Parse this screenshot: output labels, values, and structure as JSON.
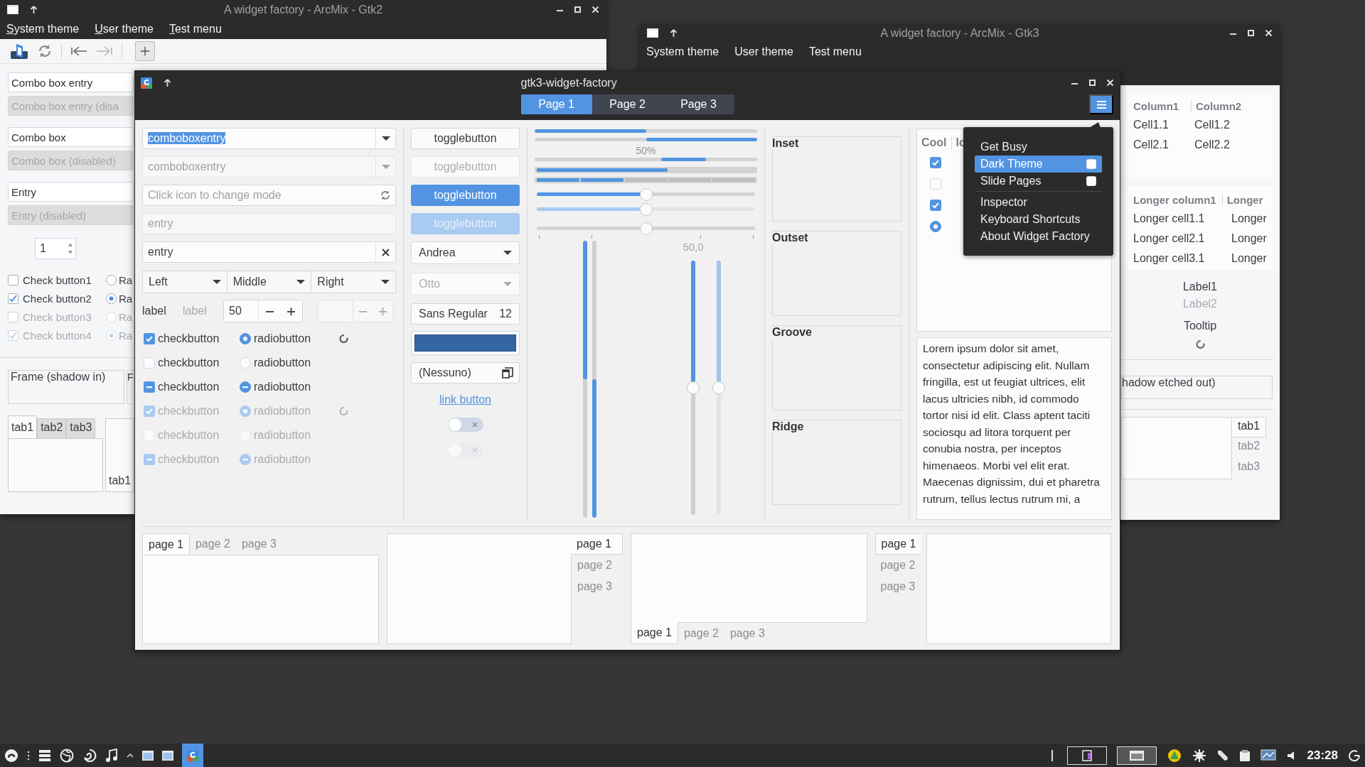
{
  "gtk2_window": {
    "title": "A widget factory - ArcMix - Gtk2",
    "menus": [
      "System theme",
      "User theme",
      "Test menu"
    ],
    "field_groups": [
      {
        "fields": [
          {
            "text": "Combo box entry",
            "disabled": false
          },
          {
            "text": "Combo box entry (disa",
            "disabled": true
          }
        ]
      },
      {
        "fields": [
          {
            "text": "Combo box",
            "disabled": false
          },
          {
            "text": "Combo box (disabled)",
            "disabled": true
          }
        ]
      },
      {
        "fields": [
          {
            "text": "Entry",
            "disabled": false
          },
          {
            "text": "Entry (disabled)",
            "disabled": true
          }
        ]
      }
    ],
    "spin": {
      "value": "1"
    },
    "check_rows": [
      {
        "label": "Check button1",
        "checked": false,
        "radio": "Ra",
        "radio_selected": false,
        "disabled": false
      },
      {
        "label": "Check button2",
        "checked": true,
        "radio": "Ra",
        "radio_selected": true,
        "disabled": false
      },
      {
        "label": "Check button3",
        "checked": false,
        "radio": "Ra",
        "radio_selected": false,
        "disabled": true
      },
      {
        "label": "Check button4",
        "checked": true,
        "radio": "Ra",
        "radio_selected": true,
        "disabled": true
      }
    ],
    "frames": [
      "Frame (shadow in)",
      "F"
    ],
    "notebook_tabs": [
      {
        "label": "tab1",
        "selected": true
      },
      {
        "label": "tab2",
        "selected": false
      },
      {
        "label": "tab3",
        "selected": false
      }
    ],
    "notebook2_tab": "tab1"
  },
  "gtk3_window": {
    "title": "A widget factory - ArcMix - Gtk3",
    "menus": [
      "System theme",
      "User theme",
      "Test menu"
    ],
    "trees": [
      {
        "columns": [
          "Column1",
          "Column2"
        ],
        "rows": [
          [
            "Cell1.1",
            "Cell1.2"
          ],
          [
            "Cell2.1",
            "Cell2.2"
          ]
        ]
      },
      {
        "columns": [
          "Longer column1",
          "Longer"
        ],
        "rows": [
          [
            "Longer cell1.1",
            "Longer"
          ],
          [
            "Longer cell2.1",
            "Longer"
          ],
          [
            "Longer cell3.1",
            "Longer"
          ]
        ]
      }
    ],
    "labels": [
      {
        "text": "Label1",
        "disabled": false
      },
      {
        "text": "Label2",
        "disabled": true
      }
    ],
    "tooltip_label": "Tooltip",
    "frame": "hadow etched out)",
    "tabs": [
      {
        "label": "tab1",
        "selected": true
      },
      {
        "label": "tab2",
        "selected": false
      },
      {
        "label": "tab3",
        "selected": false
      }
    ]
  },
  "main_window": {
    "title": "gtk3-widget-factory",
    "pages": [
      {
        "label": "Page 1",
        "selected": true
      },
      {
        "label": "Page 2",
        "selected": false
      },
      {
        "label": "Page 3",
        "selected": false
      }
    ],
    "combo_entries": [
      {
        "text": "comboboxentry",
        "disabled": false,
        "text_selected": true
      },
      {
        "text": "comboboxentry",
        "disabled": true,
        "text_selected": false
      }
    ],
    "entries": [
      {
        "kind": "icon",
        "placeholder": "Click icon to change mode",
        "disabled": false
      },
      {
        "kind": "plain",
        "value": "entry",
        "disabled": true
      },
      {
        "kind": "clear",
        "value": "entry",
        "disabled": false
      }
    ],
    "linked_combos": [
      "Left",
      "Middle",
      "Right"
    ],
    "labels": [
      {
        "text": "label",
        "disabled": false
      },
      {
        "text": "label",
        "disabled": true
      }
    ],
    "spin_buttons": [
      {
        "value": "50",
        "disabled": false
      },
      {
        "disabled": true
      }
    ],
    "check_rows": [
      {
        "kind": "normal",
        "check": "checkbutton",
        "radio": "radiobutton",
        "checked": true,
        "disabled": false,
        "spinner": true
      },
      {
        "kind": "normal",
        "check": "checkbutton",
        "radio": "radiobutton",
        "checked": false,
        "disabled": false,
        "spinner": false
      },
      {
        "kind": "mixed",
        "check": "checkbutton",
        "radio": "radiobutton",
        "disabled": false,
        "spinner": false
      },
      {
        "kind": "normal",
        "check": "checkbutton",
        "radio": "radiobutton",
        "checked": true,
        "disabled": true,
        "spinner": true
      },
      {
        "kind": "normal",
        "check": "checkbutton",
        "radio": "radiobutton",
        "checked": false,
        "disabled": true,
        "spinner": false
      },
      {
        "kind": "mixed",
        "check": "checkbutton",
        "radio": "radiobutton",
        "disabled": true,
        "spinner": false
      }
    ],
    "toggle_buttons": [
      {
        "label": "togglebutton",
        "active": false,
        "disabled": false
      },
      {
        "label": "togglebutton",
        "active": false,
        "disabled": true
      },
      {
        "label": "togglebutton",
        "active": true,
        "disabled": false
      },
      {
        "label": "togglebutton",
        "active": true,
        "disabled": true
      }
    ],
    "combos": [
      {
        "text": "Andrea",
        "disabled": false
      },
      {
        "text": "Otto",
        "disabled": true
      }
    ],
    "font_button": {
      "name": "Sans Regular",
      "size": "12"
    },
    "color_button": {
      "color": "#3465a4"
    },
    "file_button": {
      "text": "(Nessuno)"
    },
    "link_button": {
      "text": "link button"
    },
    "switches": [
      {
        "on": false,
        "disabled": false
      },
      {
        "on": false,
        "disabled": true
      }
    ],
    "progress_bars": [
      {
        "level": 0.5,
        "inverted": false
      },
      {
        "level": 0.5,
        "inverted": true
      }
    ],
    "pulse_bar": {
      "text": "50%"
    },
    "level_bars": [
      {
        "kind": "continuous",
        "level": 0.6
      },
      {
        "kind": "discrete",
        "level": 0.4
      }
    ],
    "scales": [
      {
        "level": 0.5,
        "disabled": false,
        "marks": false
      },
      {
        "level": 0.5,
        "disabled": true,
        "marks": false
      },
      {
        "level": 0.5,
        "disabled": false,
        "marks": true
      }
    ],
    "vertical_bars": [
      {
        "level": 0.5,
        "inverted": false
      },
      {
        "level": 0.5,
        "inverted": true
      }
    ],
    "vertical_scales": [
      {
        "level": 0.5,
        "disabled": false,
        "value_text": "50,0"
      },
      {
        "level": 0.5,
        "disabled": true
      }
    ],
    "frames": [
      "Inset",
      "Outset",
      "Groove",
      "Ridge"
    ],
    "tree": {
      "columns": [
        "Cool",
        "Ic"
      ],
      "rows": [
        {
          "kind": "check",
          "checked": true
        },
        {
          "kind": "check",
          "checked": false
        },
        {
          "kind": "check",
          "checked": true
        },
        {
          "kind": "radio",
          "checked": true
        }
      ]
    },
    "text_view": "Lorem ipsum dolor sit amet, consectetur adipiscing elit. Nullam fringilla, est ut feugiat ultrices, elit lacus ultricies nibh, id commodo tortor nisi id elit. Class aptent taciti sociosqu ad litora torquent per conubia nostra, per inceptos himenaeos. Morbi vel elit erat. Maecenas dignissim, dui et pharetra rutrum, tellus lectus rutrum mi, a",
    "menu": [
      {
        "kind": "item",
        "label": "Get Busy",
        "highlighted": false
      },
      {
        "kind": "check",
        "label": "Dark Theme",
        "checked": false,
        "highlighted": true
      },
      {
        "kind": "check",
        "label": "Slide Pages",
        "checked": false,
        "highlighted": false
      },
      {
        "kind": "separator"
      },
      {
        "kind": "item",
        "label": "Inspector",
        "highlighted": false
      },
      {
        "kind": "item",
        "label": "Keyboard Shortcuts",
        "highlighted": false
      },
      {
        "kind": "item",
        "label": "About Widget Factory",
        "highlighted": false
      }
    ],
    "notebooks": [
      {
        "kind": "top",
        "tabs": [
          {
            "label": "page 1",
            "selected": true
          },
          {
            "label": "page 2",
            "selected": false
          },
          {
            "label": "page 3",
            "selected": false
          }
        ]
      },
      {
        "kind": "right",
        "tabs": [
          {
            "label": "page 1",
            "selected": true
          },
          {
            "label": "page 2",
            "selected": false
          },
          {
            "label": "page 3",
            "selected": false
          }
        ]
      },
      {
        "kind": "bottom",
        "tabs": [
          {
            "label": "page 1",
            "selected": true
          },
          {
            "label": "page 2",
            "selected": false
          },
          {
            "label": "page 3",
            "selected": false
          }
        ]
      },
      {
        "kind": "left",
        "tabs": [
          {
            "label": "page 1",
            "selected": true
          },
          {
            "label": "page 2",
            "selected": false
          },
          {
            "label": "page 3",
            "selected": false
          }
        ]
      }
    ]
  },
  "taskbar": {
    "clock": "23:28"
  }
}
